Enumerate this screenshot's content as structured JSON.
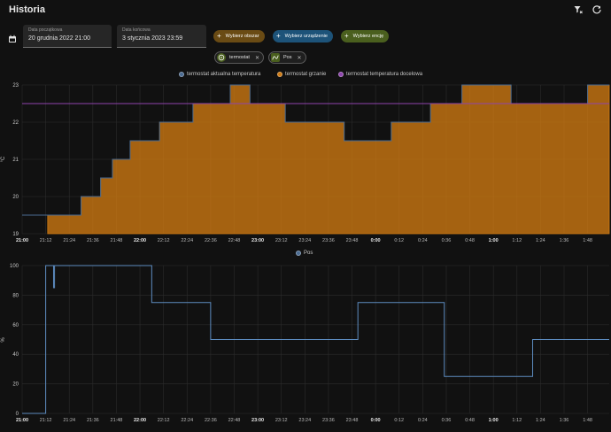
{
  "header": {
    "title": "Historia",
    "icons": [
      "filter-remove-icon",
      "refresh-icon"
    ]
  },
  "date_range": {
    "start_label": "Data początkowa",
    "start_value": "20 grudnia 2022 21:00",
    "end_label": "Data końcowa",
    "end_value": "3 stycznia 2023 23:59"
  },
  "target_buttons": {
    "area": "Wybierz obszar",
    "device": "Wybierz urządzenie",
    "entity": "Wybierz encję"
  },
  "chips": [
    {
      "label": "termostat",
      "icon": "thermostat-icon"
    },
    {
      "label": "Pos",
      "icon": "sine-wave-icon"
    }
  ],
  "colors": {
    "area_button": "#6a4b14",
    "device_button": "#1d5379",
    "entity_button": "#4a5f1e",
    "current_temp": "#4a6b91",
    "heating": "#d07a12",
    "target_temp": "#8e44ad",
    "pos_line": "#5d8cc0"
  },
  "chart_data": [
    {
      "type": "area",
      "legend": [
        "termostat aktualna temperatura",
        "termostat grzanie",
        "termostat temperatura docelowa"
      ],
      "ylabel": "°C",
      "y_ticks": [
        "23",
        "22",
        "21",
        "20",
        "19"
      ],
      "ylim": [
        19,
        23
      ],
      "x_ticks": [
        "21:00",
        "21:12",
        "21:24",
        "21:36",
        "21:48",
        "22:00",
        "22:12",
        "22:24",
        "22:36",
        "22:48",
        "23:00",
        "23:12",
        "23:24",
        "23:36",
        "23:48",
        "0:00",
        "0:12",
        "0:24",
        "0:36",
        "0:48",
        "1:00",
        "1:12",
        "1:24",
        "1:36",
        "1:48"
      ],
      "x_ticks_bold": [
        "21:00",
        "22:00",
        "23:00",
        "0:00",
        "1:00"
      ],
      "xlim_minutes": [
        0,
        299
      ],
      "current_temperature": {
        "name": "termostat aktualna temperatura",
        "x_minutes": [
          0,
          13,
          30,
          40,
          46,
          55,
          70,
          87,
          106,
          116,
          134,
          164,
          188,
          208,
          224,
          249,
          270,
          288,
          299
        ],
        "values": [
          19.5,
          19.5,
          20.0,
          20.5,
          21.0,
          21.5,
          22.0,
          22.5,
          23.0,
          22.5,
          22.0,
          21.5,
          22.0,
          22.5,
          23.0,
          22.5,
          22.5,
          23.0,
          23.0
        ]
      },
      "heating": {
        "name": "termostat grzanie",
        "x_minutes": [
          0,
          13,
          30,
          40,
          46,
          55,
          70,
          87,
          106,
          116,
          134,
          164,
          188,
          208,
          224,
          249,
          270,
          288,
          299
        ],
        "values": [
          19.5,
          19.5,
          20.0,
          20.5,
          21.0,
          21.5,
          22.0,
          22.5,
          23.0,
          22.5,
          22.0,
          21.5,
          22.0,
          22.5,
          23.0,
          22.5,
          22.5,
          23.0,
          23.0
        ],
        "heating_start_minute": 13
      },
      "target_temperature": {
        "name": "termostat temperatura docelowa",
        "value": 22.5
      }
    },
    {
      "type": "line",
      "legend": [
        "Pos"
      ],
      "ylabel": "%",
      "y_ticks": [
        "100",
        "80",
        "60",
        "40",
        "20",
        "0"
      ],
      "ylim": [
        0,
        100
      ],
      "x_ticks": [
        "21:00",
        "21:12",
        "21:24",
        "21:36",
        "21:48",
        "22:00",
        "22:12",
        "22:24",
        "22:36",
        "22:48",
        "23:00",
        "23:12",
        "23:24",
        "23:36",
        "23:48",
        "0:00",
        "0:12",
        "0:24",
        "0:36",
        "0:48",
        "1:00",
        "1:12",
        "1:24",
        "1:36",
        "1:48"
      ],
      "x_ticks_bold": [
        "21:00",
        "22:00",
        "23:00",
        "0:00",
        "1:00"
      ],
      "xlim_minutes": [
        0,
        299
      ],
      "series": [
        {
          "name": "Pos",
          "x_minutes": [
            0,
            12,
            12,
            16,
            16,
            16.5,
            16.5,
            66,
            66,
            96,
            96,
            171,
            171,
            215,
            215,
            260,
            260,
            299
          ],
          "values": [
            0,
            0,
            100,
            100,
            85,
            85,
            100,
            100,
            75,
            75,
            50,
            50,
            75,
            75,
            25,
            25,
            50,
            50
          ]
        }
      ]
    }
  ]
}
